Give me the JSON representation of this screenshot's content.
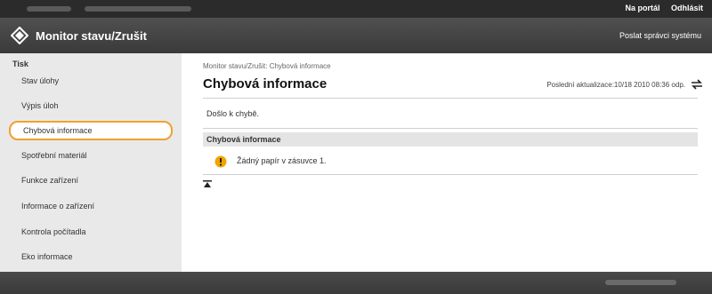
{
  "topbar": {
    "portal_link": "Na portál",
    "logout_link": "Odhlásit"
  },
  "header": {
    "title": "Monitor stavu/Zrušit",
    "send_admin": "Poslat správci systému"
  },
  "sidebar": {
    "section": "Tisk",
    "items": [
      {
        "label": "Stav úlohy"
      },
      {
        "label": "Výpis úloh"
      },
      {
        "label": "Chybová informace"
      },
      {
        "label": "Spotřební materiál"
      },
      {
        "label": "Funkce zařízení"
      },
      {
        "label": "Informace o zařízení"
      },
      {
        "label": "Kontrola počítadla"
      },
      {
        "label": "Eko informace"
      }
    ]
  },
  "main": {
    "breadcrumb": "Monitor stavu/Zrušit: Chybová informace",
    "title": "Chybová informace",
    "last_update": "Poslední aktualizace:10/18 2010 08:36 odp.",
    "status_text": "Došlo k chybě.",
    "section_title": "Chybová informace",
    "error_message": "Žádný papír v zásuvce 1."
  },
  "colors": {
    "highlight": "#f0a030",
    "warning": "#f0a500"
  }
}
